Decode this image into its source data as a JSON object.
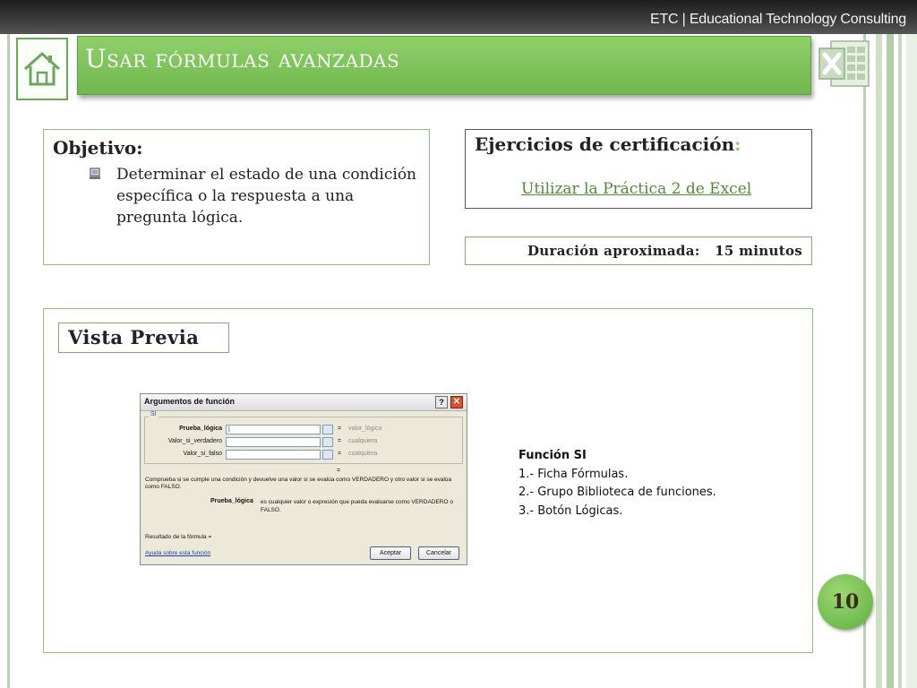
{
  "header": {
    "brand": "ETC | Educational Technology Consulting",
    "title": "Usar fórmulas avanzadas"
  },
  "objective": {
    "title": "Objetivo:",
    "text": "Determinar el estado de una condición específica o la respuesta a una pregunta lógica."
  },
  "certification": {
    "title": "Ejercicios de  certificación",
    "colon": ":",
    "link": "Utilizar la Práctica 2 de Excel"
  },
  "duration": {
    "text": "Duración aproximada:   15 minutos"
  },
  "preview": {
    "label": "Vista Previa",
    "dialog": {
      "title": "Argumentos de función",
      "help_button": "?",
      "close_button": "✕",
      "group_label": "SI",
      "args": [
        {
          "label": "Prueba_lógica",
          "value": "|",
          "result": "valor_lógico"
        },
        {
          "label": "Valor_si_verdadero",
          "value": "",
          "result": "cualquiera"
        },
        {
          "label": "Valor_si_falso",
          "value": "",
          "result": "cualquiera"
        }
      ],
      "equals": "=",
      "description": "Comprueba si se cumple una condición y devuelve una valor si se evalúa como VERDADERO y otro valor si se evalúa como FALSO.",
      "param_name": "Prueba_lógica",
      "param_desc": "es cualquier valor o expresión que pueda evaluarse como VERDADERO o FALSO.",
      "result_label": "Resultado de la fórmula =",
      "help_link": "Ayuda sobre esta función",
      "ok_label": "Aceptar",
      "cancel_label": "Cancelar"
    },
    "steps": {
      "title": "Función SI",
      "items": [
        "1.- Ficha Fórmulas.",
        "2.- Grupo Biblioteca de funciones.",
        "3.- Botón Lógicas."
      ]
    }
  },
  "page_number": "10",
  "icons": {
    "home": "home-icon",
    "excel": "excel-logo-icon",
    "bullet": "computer-bullet-icon"
  },
  "colors": {
    "accent_green": "#6fb84d",
    "link_green": "#4f8b35",
    "header_dark": "#2a2a2a"
  }
}
